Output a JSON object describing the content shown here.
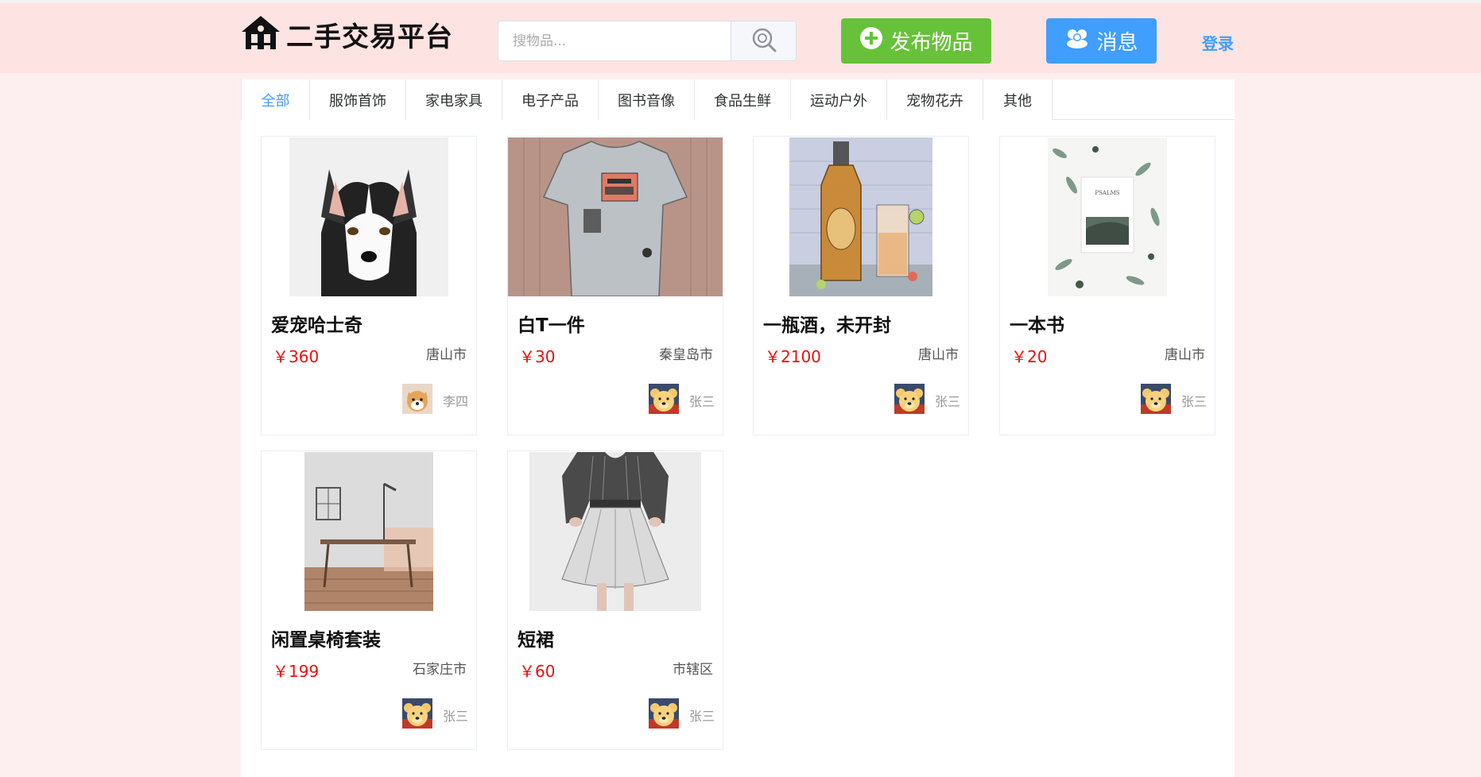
{
  "header": {
    "logo_text": "二手交易平台",
    "search_placeholder": "搜物品...",
    "publish_label": "发布物品",
    "message_label": "消息",
    "login_label": "登录"
  },
  "tabs": [
    {
      "label": "全部",
      "active": true
    },
    {
      "label": "服饰首饰"
    },
    {
      "label": "家电家具"
    },
    {
      "label": "电子产品"
    },
    {
      "label": "图书音像"
    },
    {
      "label": "食品生鲜"
    },
    {
      "label": "运动户外"
    },
    {
      "label": "宠物花卉"
    },
    {
      "label": "其他"
    }
  ],
  "products": [
    {
      "title": "爱宠哈士奇",
      "price": "￥360",
      "city": "唐山市",
      "user": "李四",
      "image": "husky-dog-photo",
      "avatar": "shiba-avatar"
    },
    {
      "title": "白T一件",
      "price": "￥30",
      "city": "秦皇岛市",
      "user": "张三",
      "image": "white-tshirt-photo",
      "avatar": "bear-avatar"
    },
    {
      "title": "一瓶酒，未开封",
      "price": "￥2100",
      "city": "唐山市",
      "user": "张三",
      "image": "liquor-bottle-photo",
      "avatar": "bear-avatar"
    },
    {
      "title": "一本书",
      "price": "￥20",
      "city": "唐山市",
      "user": "张三",
      "image": "book-photo",
      "avatar": "bear-avatar"
    },
    {
      "title": "闲置桌椅套装",
      "price": "￥199",
      "city": "石家庄市",
      "user": "张三",
      "image": "desk-chair-photo",
      "avatar": "bear-avatar"
    },
    {
      "title": "短裙",
      "price": "￥60",
      "city": "市辖区",
      "user": "张三",
      "image": "skirt-photo",
      "avatar": "bear-avatar"
    }
  ],
  "colors": {
    "accent_blue": "#409eff",
    "publish_green": "#67c23a",
    "price_red": "#f20d0d",
    "header_bg": "#fde4e2",
    "page_bg": "#fdeff0"
  }
}
